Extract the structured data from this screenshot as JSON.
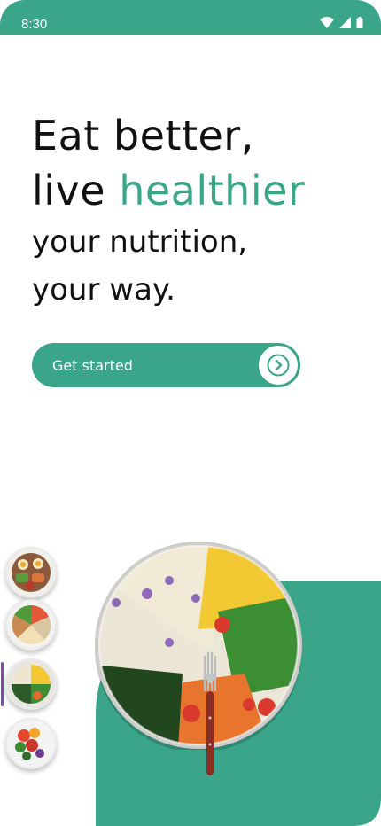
{
  "status_bar": {
    "time": "8:30"
  },
  "hero": {
    "line1": "Eat better,",
    "line2_prefix": "live ",
    "line2_accent": "healthier",
    "line3": "your nutrition,",
    "line4": "your way."
  },
  "cta": {
    "label": "Get started"
  },
  "thumbnails": [
    {
      "name": "meal-1"
    },
    {
      "name": "meal-2"
    },
    {
      "name": "meal-3",
      "active": true
    },
    {
      "name": "meal-4"
    }
  ],
  "colors": {
    "brand": "#3ba58a",
    "active_indicator": "#7d4ab6"
  }
}
